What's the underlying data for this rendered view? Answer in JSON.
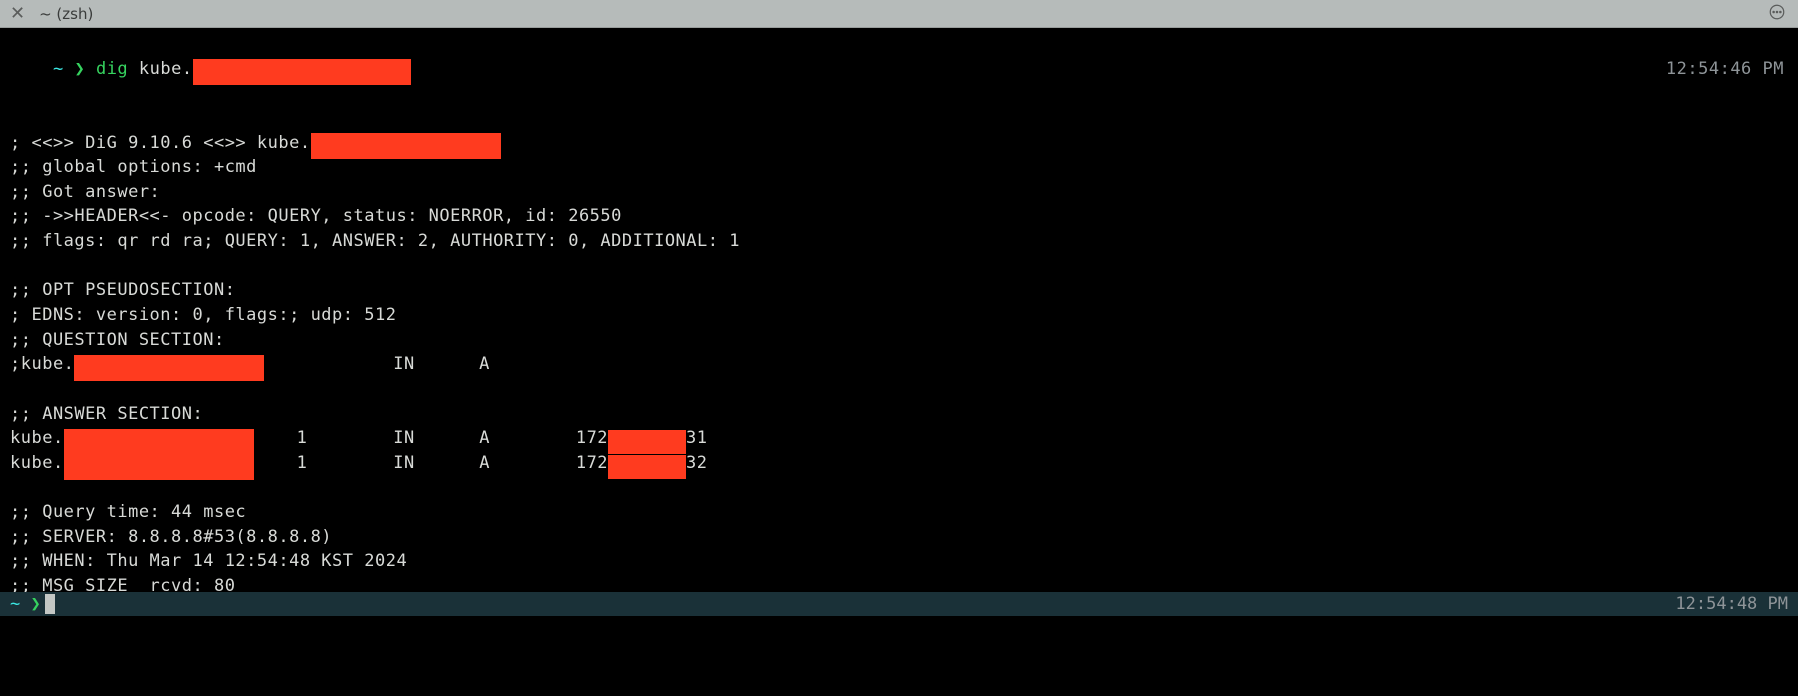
{
  "titlebar": {
    "close": "✕",
    "title": "~ (zsh)"
  },
  "prompt": {
    "tilde": "~",
    "caret": "❯",
    "command_name": "dig",
    "command_arg_prefix": "kube."
  },
  "timestamps": {
    "top": "12:54:46 PM",
    "bottom": "12:54:48 PM"
  },
  "dig": {
    "banner_pre": "; <<>> DiG 9.10.6 <<>> kube.",
    "global_options": ";; global options: +cmd",
    "got_answer": ";; Got answer:",
    "header": ";; ->>HEADER<<- opcode: QUERY, status: NOERROR, id: 26550",
    "flags": ";; flags: qr rd ra; QUERY: 1, ANSWER: 2, AUTHORITY: 0, ADDITIONAL: 1",
    "opt_header": ";; OPT PSEUDOSECTION:",
    "edns": "; EDNS: version: 0, flags:; udp: 512",
    "question_header": ";; QUESTION SECTION:",
    "question_line_pre": ";kube.",
    "question_class": "IN",
    "question_type": "A",
    "answer_header": ";; ANSWER SECTION:",
    "answers": [
      {
        "name_pre": "kube.",
        "ttl": "1",
        "class": "IN",
        "type": "A",
        "ip_pre": "172",
        "ip_post": "31"
      },
      {
        "name_pre": "kube.",
        "ttl": "1",
        "class": "IN",
        "type": "A",
        "ip_pre": "172",
        "ip_post": "32"
      }
    ],
    "query_time": ";; Query time: 44 msec",
    "server": ";; SERVER: 8.8.8.8#53(8.8.8.8)",
    "when": ";; WHEN: Thu Mar 14 12:54:48 KST 2024",
    "msg_size": ";; MSG SIZE  rcvd: 80"
  }
}
